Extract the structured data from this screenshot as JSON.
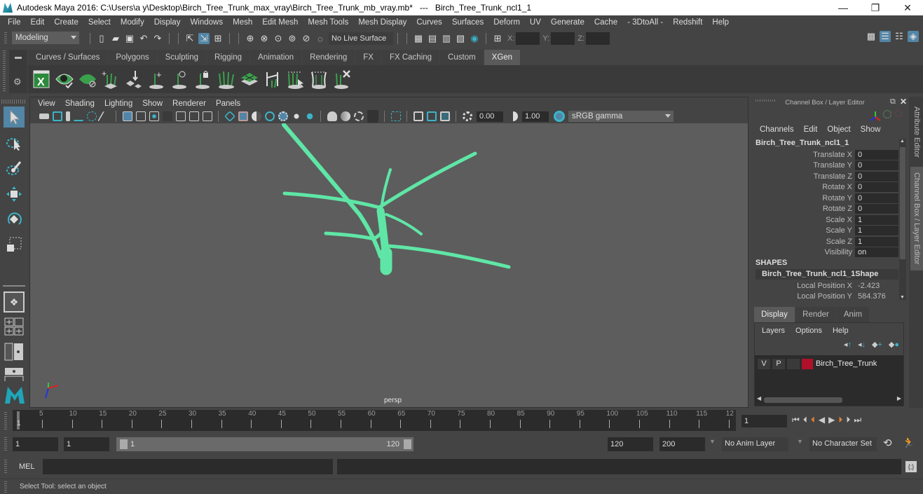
{
  "window": {
    "title": "Autodesk Maya 2016: C:\\Users\\a y\\Desktop\\Birch_Tree_Trunk_max_vray\\Birch_Tree_Trunk_mb_vray.mb*   ---   Birch_Tree_Trunk_ncl1_1",
    "minimize": "—",
    "maximize": "❐",
    "close": "✕"
  },
  "menubar": [
    "File",
    "Edit",
    "Create",
    "Select",
    "Modify",
    "Display",
    "Windows",
    "Mesh",
    "Edit Mesh",
    "Mesh Tools",
    "Mesh Display",
    "Curves",
    "Surfaces",
    "Deform",
    "UV",
    "Generate",
    "Cache",
    "- 3DtoAll -",
    "Redshift",
    "Help"
  ],
  "statusline": {
    "mode": "Modeling",
    "live_surface": "No Live Surface",
    "x_label": "X:",
    "y_label": "Y:",
    "z_label": "Z:",
    "x_value": "",
    "y_value": "",
    "z_value": ""
  },
  "shelf": {
    "tabs": [
      "Curves / Surfaces",
      "Polygons",
      "Sculpting",
      "Rigging",
      "Animation",
      "Rendering",
      "FX",
      "FX Caching",
      "Custom",
      "XGen"
    ],
    "active_tab": "XGen",
    "icons": [
      "xgen-window-icon",
      "xgen-preview-icon",
      "xgen-clear-preview-icon",
      "add-guides-icon",
      "place-guides-icon",
      "add-guide-icon",
      "guide-sculpt-icon",
      "lock-guide-icon",
      "guide-grass-icon",
      "xgen-patch-icon",
      "guide-tool-icon",
      "xgen-fx-icon",
      "xgen-modifier-icon",
      "delete-guides-icon"
    ]
  },
  "viewport": {
    "menu": [
      "View",
      "Shading",
      "Lighting",
      "Show",
      "Renderer",
      "Panels"
    ],
    "exposure": "0.00",
    "gamma": "1.00",
    "color_space": "sRGB gamma",
    "camera_label": "persp",
    "mesh_color": "#5fe6a6"
  },
  "channelbox": {
    "title": "Channel Box / Layer Editor",
    "menu": [
      "Channels",
      "Edit",
      "Object",
      "Show"
    ],
    "object_name": "Birch_Tree_Trunk_ncl1_1",
    "channels": [
      {
        "label": "Translate X",
        "value": "0"
      },
      {
        "label": "Translate Y",
        "value": "0"
      },
      {
        "label": "Translate Z",
        "value": "0"
      },
      {
        "label": "Rotate X",
        "value": "0"
      },
      {
        "label": "Rotate Y",
        "value": "0"
      },
      {
        "label": "Rotate Z",
        "value": "0"
      },
      {
        "label": "Scale X",
        "value": "1"
      },
      {
        "label": "Scale Y",
        "value": "1"
      },
      {
        "label": "Scale Z",
        "value": "1"
      },
      {
        "label": "Visibility",
        "value": "on"
      }
    ],
    "shapes_header": "SHAPES",
    "shape_name": "Birch_Tree_Trunk_ncl1_1Shape",
    "shape_channels": [
      {
        "label": "Local Position X",
        "value": "-2.423"
      },
      {
        "label": "Local Position Y",
        "value": "584.376"
      }
    ]
  },
  "sidetabs": {
    "attribute_editor": "Attribute Editor",
    "channel_box": "Channel Box / Layer Editor"
  },
  "layers": {
    "tabs": [
      "Display",
      "Render",
      "Anim"
    ],
    "active_tab": "Display",
    "menu": [
      "Layers",
      "Options",
      "Help"
    ],
    "items": [
      {
        "v": "V",
        "p": "P",
        "name": "Birch_Tree_Trunk",
        "color": "#b0102a"
      }
    ]
  },
  "timeline": {
    "ticks": [
      "5",
      "10",
      "15",
      "20",
      "25",
      "30",
      "35",
      "40",
      "45",
      "50",
      "55",
      "60",
      "65",
      "70",
      "75",
      "80",
      "85",
      "90",
      "95",
      "100",
      "105",
      "110",
      "115",
      "12"
    ],
    "current_frame_marker": "1",
    "current_frame": "1"
  },
  "range": {
    "start": "1",
    "playback_start": "1",
    "slider_start": "1",
    "slider_end": "120",
    "playback_end": "120",
    "end": "200",
    "anim_layer": "No Anim Layer",
    "character_set": "No Character Set"
  },
  "cmdline": {
    "label": "MEL",
    "input": "",
    "result": ""
  },
  "helpline": {
    "text": "Select Tool: select an object"
  }
}
